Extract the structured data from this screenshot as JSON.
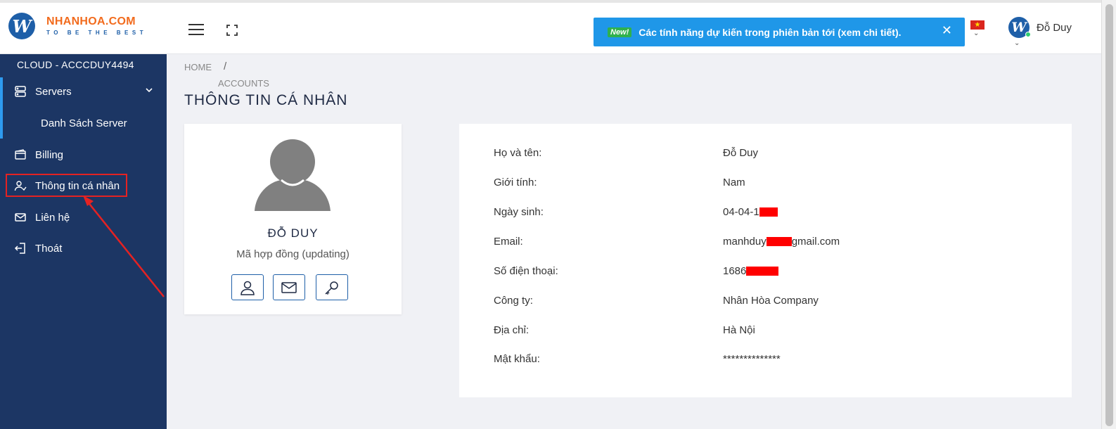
{
  "brand": {
    "logo_letter": "W",
    "name": "NHANHOA.COM",
    "slogan": "TO BE THE BEST",
    "orange": "#f26b1d",
    "blue": "#1e5fa8"
  },
  "header": {
    "notice": {
      "badge": "New!",
      "text": "Các tính năng dự kiến trong phiên bản tới (xem chi tiết).",
      "close": "✕",
      "color": "#1f97e8"
    },
    "language_flag": "vietnam-flag-icon",
    "user": {
      "avatar_letter": "W",
      "name": "Đỗ Duy",
      "online": true
    }
  },
  "sidebar": {
    "account": "CLOUD - ACCCDUY4494",
    "items": [
      {
        "label": "Servers",
        "icon": "server-icon",
        "expanded": true
      },
      {
        "label": "Danh Sách Server",
        "icon": ""
      },
      {
        "label": "Billing",
        "icon": "wallet-icon"
      },
      {
        "label": "Thông tin cá nhân",
        "icon": "user-check-icon",
        "highlighted": true
      },
      {
        "label": "Liên hệ",
        "icon": "mail-icon"
      },
      {
        "label": "Thoát",
        "icon": "logout-icon"
      }
    ],
    "bg": "#1c3664",
    "highlight_color": "#e52222"
  },
  "breadcrumb": {
    "home": "HOME",
    "separator": "/",
    "current": "ACCOUNTS"
  },
  "page_title": "THÔNG TIN CÁ NHÂN",
  "profile": {
    "name": "ĐỖ DUY",
    "contract": "Mã hợp đồng (updating)",
    "buttons": [
      "user-icon",
      "mail-icon",
      "key-icon"
    ]
  },
  "info": {
    "rows": [
      {
        "label": "Họ và tên:",
        "value": "Đỗ Duy"
      },
      {
        "label": "Giới tính:",
        "value": "Nam"
      },
      {
        "label": "Ngày sinh:",
        "value": "04-04-1"
      },
      {
        "label": "Email:",
        "value_prefix": "manhduy",
        "value_suffix": "gmail.com"
      },
      {
        "label": "Số điện thoại:",
        "value": "1686"
      },
      {
        "label": "Công ty:",
        "value": "Nhân Hòa Company"
      },
      {
        "label": "Địa chỉ:",
        "value": "Hà Nội"
      },
      {
        "label": "Mật khẩu:",
        "value": "**************"
      }
    ]
  }
}
